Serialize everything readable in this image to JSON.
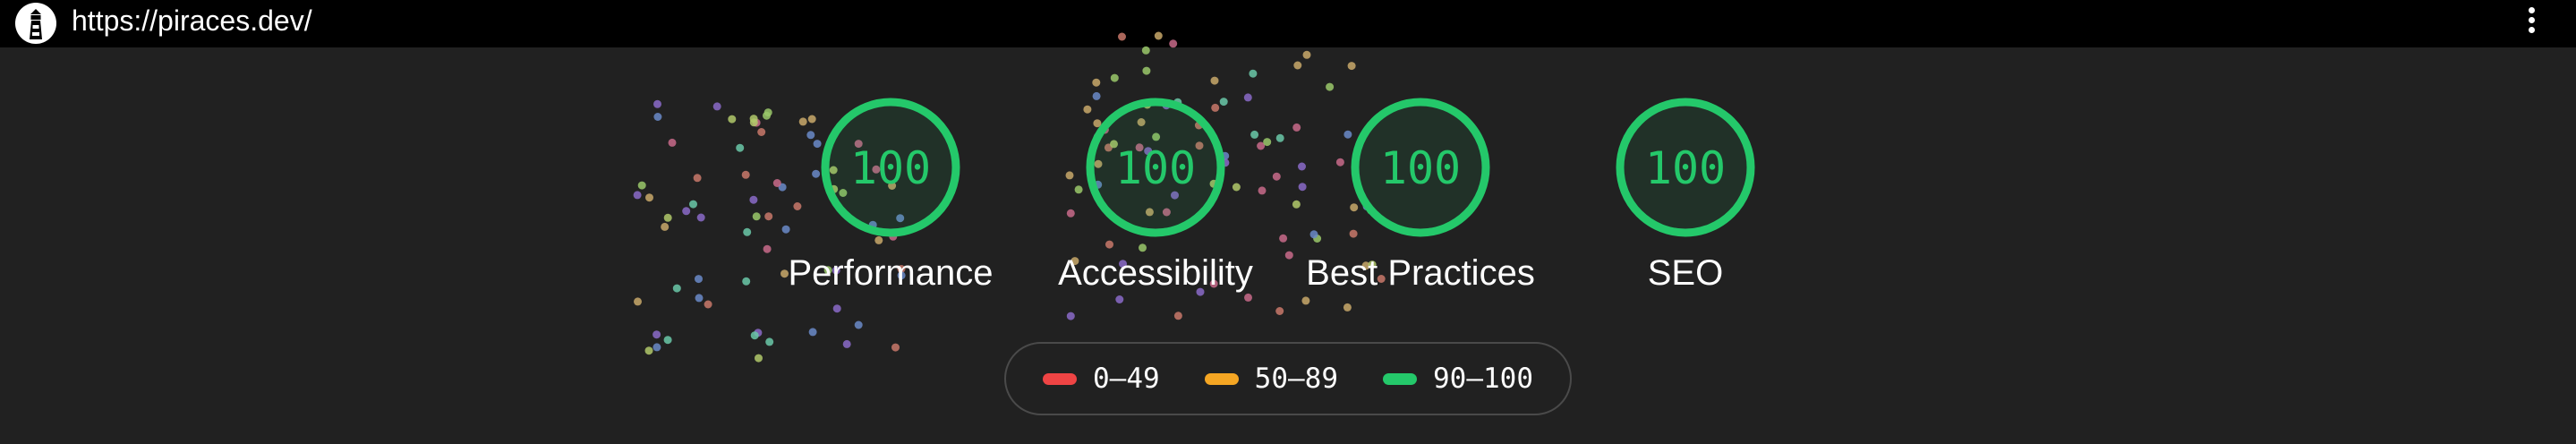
{
  "address_bar": {
    "url": "https://piraces.dev/"
  },
  "icons": {
    "logo": "lighthouse-icon",
    "menu": "vertical-ellipsis-icon"
  },
  "scores": [
    {
      "label": "Performance",
      "value": "100"
    },
    {
      "label": "Accessibility",
      "value": "100"
    },
    {
      "label": "Best Practices",
      "value": "100"
    },
    {
      "label": "SEO",
      "value": "100"
    }
  ],
  "legend": [
    {
      "range": "0–49",
      "color": "#ef4444"
    },
    {
      "range": "50–89",
      "color": "#f5a623"
    },
    {
      "range": "90–100",
      "color": "#24c86a"
    }
  ],
  "colors": {
    "pass": "#24c86a",
    "background": "#212121",
    "topbar": "#000000"
  }
}
